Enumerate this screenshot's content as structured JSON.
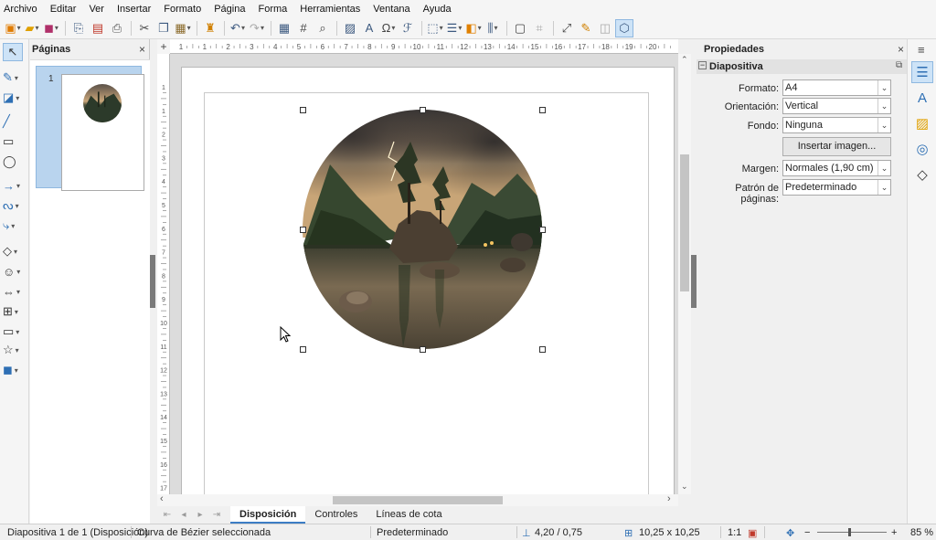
{
  "menu": [
    "Archivo",
    "Editar",
    "Ver",
    "Insertar",
    "Formato",
    "Página",
    "Forma",
    "Herramientas",
    "Ventana",
    "Ayuda"
  ],
  "icons": {
    "colors": {
      "accent": "#2e6fb4",
      "selection": "#cde3f7",
      "handle_bar": "#7a7a7a"
    }
  },
  "pages_pane": {
    "title": "Páginas",
    "close": "×",
    "thumb_number": "1"
  },
  "ruler": {
    "corner": "+",
    "h_ticks": [
      "1",
      "1",
      "2",
      "3",
      "4",
      "5",
      "6",
      "7",
      "8",
      "9",
      "10",
      "11",
      "12",
      "13",
      "14",
      "15",
      "16",
      "17",
      "18",
      "19",
      "20"
    ],
    "v_ticks": [
      "1",
      "1",
      "2",
      "3",
      "4",
      "5",
      "6",
      "7",
      "8",
      "9",
      "10",
      "11",
      "12",
      "13",
      "14",
      "15",
      "16",
      "17"
    ]
  },
  "tabs": {
    "items": [
      "Disposición",
      "Controles",
      "Líneas de cota"
    ],
    "active": "Disposición"
  },
  "properties": {
    "title": "Propiedades",
    "close": "×",
    "menu": "≡",
    "section": "Diapositiva",
    "format_label": "Formato:",
    "format_value": "A4",
    "orientation_label": "Orientación:",
    "orientation_value": "Vertical",
    "background_label": "Fondo:",
    "background_value": "Ninguna",
    "insert_image": "Insertar imagen...",
    "margin_label": "Margen:",
    "margin_value": "Normales (1,90 cm)",
    "master_label": "Patrón de páginas:",
    "master_value": "Predeterminado"
  },
  "status": {
    "slide": "Diapositiva 1 de 1 (Disposición)",
    "selection": "Curva de Bézier seleccionada",
    "master": "Predeterminado",
    "position": "4,20 / 0,75",
    "size": "10,25 x 10,25",
    "scale": "1:1",
    "zoom_minus": "−",
    "zoom_plus": "+",
    "zoom": "85 %"
  }
}
